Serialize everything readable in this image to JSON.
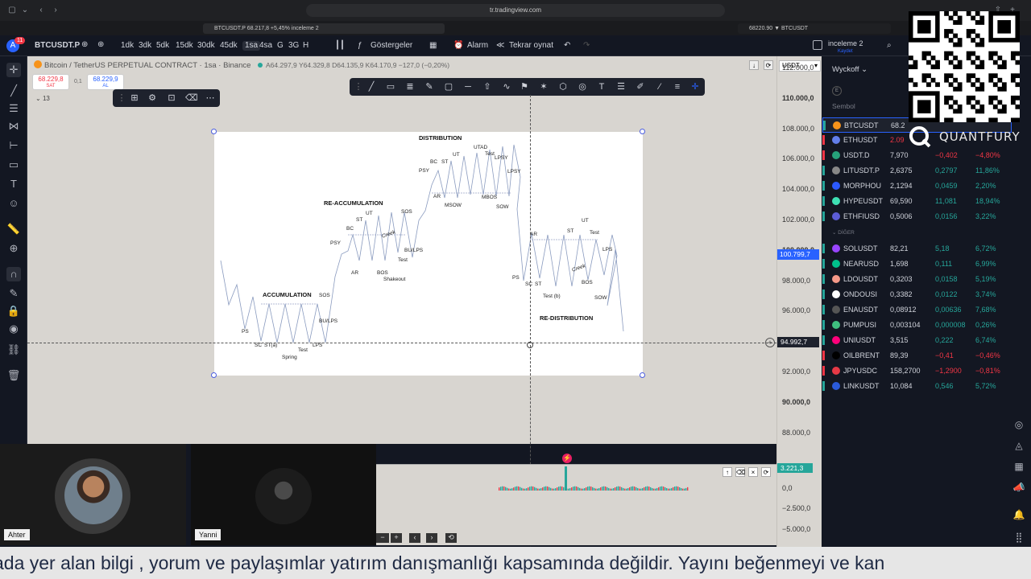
{
  "browser": {
    "url": "tr.tradingview.com"
  },
  "tabs": [
    {
      "label": "BTCUSDT.P 68.217,8 +5,45% inceleme 2"
    },
    {
      "label": "68220.90 ▼ BTCUSDT"
    }
  ],
  "toolbar": {
    "symbol": "BTCUSDT.P",
    "alert_badge": "11",
    "intervals": [
      "1dk",
      "3dk",
      "5dk",
      "15dk",
      "30dk",
      "45dk",
      "1sa",
      "4sa",
      "G",
      "3G",
      "H"
    ],
    "active_interval": "1sa",
    "indicators_label": "Göstergeler",
    "alarm_label": "Alarm",
    "replay_label": "Tekrar oynat",
    "layout_name": "inceleme 2",
    "layout_sub": "Kaydet"
  },
  "chart": {
    "title": "Bitcoin / TetherUS PERPETUAL CONTRACT · 1sa · Binance",
    "ohlc": "A64.297,9  Y64.329,8  D64.135,9  K64.170,9  −127,0 (−0,20%)",
    "sell": {
      "price": "68.229,8",
      "label": "SAT"
    },
    "spread": "0,1",
    "buy": {
      "price": "68.229,9",
      "label": "AL"
    },
    "collapse_count": "13",
    "currency": "USDT",
    "current_price": "100.799,7",
    "cursor_price": "94.992,7"
  },
  "wyckoff": {
    "accumulation": {
      "title": "ACCUMULATION",
      "labels": [
        "PS",
        "SC",
        "ST(a)",
        "Spring",
        "Test",
        "LPS",
        "SOS",
        "BU/LPS"
      ]
    },
    "reaccumulation": {
      "title": "RE-ACCUMULATION",
      "labels": [
        "PSY",
        "BC",
        "ST",
        "UT",
        "Creek",
        "SOS",
        "AR",
        "BOS",
        "Shakeout",
        "Test",
        "BU/LPS"
      ]
    },
    "distribution": {
      "title": "DISTRIBUTION",
      "labels": [
        "PSY",
        "BC",
        "ST",
        "UT",
        "UTAD",
        "Test",
        "LPSY",
        "LPSY",
        "AR",
        "MSOW",
        "MBOS",
        "SOW"
      ]
    },
    "redistribution": {
      "title": "RE-DISTRIBUTION",
      "labels": [
        "PS",
        "SC",
        "AR",
        "ST",
        "Test (b)",
        "ST",
        "UT",
        "Test",
        "Creek",
        "LPS",
        "BOS",
        "SOW"
      ]
    }
  },
  "price_axis": [
    "112.000,0",
    "110.000,0",
    "108.000,0",
    "106.000,0",
    "104.000,0",
    "102.000,0",
    "100.000,0",
    "98.000,0",
    "96.000,0",
    "94.000,0",
    "92.000,0",
    "90.000,0",
    "88.000,0"
  ],
  "indicator": {
    "value": "3.221,3",
    "ticks": [
      "0,0",
      "−2.500,0",
      "−5.000,0"
    ]
  },
  "watchlist": {
    "title": "Wyckoff",
    "column_label": "Sembol",
    "section_label": "DİĞER",
    "rows": [
      {
        "symbol": "BTCUSDT",
        "last": "68.2",
        "chg": "",
        "pct": "",
        "color": "#f7931a",
        "sign": "pos"
      },
      {
        "symbol": "ETHUSDT",
        "last": "2.09",
        "chg": "",
        "pct": "",
        "color": "#627eea",
        "sign": "neg"
      },
      {
        "symbol": "USDT.D",
        "last": "7,970",
        "chg": "−0,402",
        "pct": "−4,80%",
        "color": "#26a17b",
        "sign": "neg"
      },
      {
        "symbol": "LITUSDT.P",
        "last": "2,6375",
        "chg": "0,2797",
        "pct": "11,86%",
        "color": "#888888",
        "sign": "pos"
      },
      {
        "symbol": "MORPHOU",
        "last": "2,1294",
        "chg": "0,0459",
        "pct": "2,20%",
        "color": "#2b59ff",
        "sign": "pos"
      },
      {
        "symbol": "HYPEUSDT",
        "last": "69,590",
        "chg": "11,081",
        "pct": "18,94%",
        "color": "#3ee0b4",
        "sign": "pos"
      },
      {
        "symbol": "ETHFIUSD",
        "last": "0,5006",
        "chg": "0,0156",
        "pct": "3,22%",
        "color": "#5c5cd6",
        "sign": "pos"
      },
      {
        "symbol": "SOLUSDT",
        "last": "82,21",
        "chg": "5,18",
        "pct": "6,72%",
        "color": "#9945ff",
        "sign": "pos"
      },
      {
        "symbol": "NEARUSD",
        "last": "1,698",
        "chg": "0,111",
        "pct": "6,99%",
        "color": "#00c08b",
        "sign": "pos"
      },
      {
        "symbol": "LDOUSDT",
        "last": "0,3203",
        "chg": "0,0158",
        "pct": "5,19%",
        "color": "#f69988",
        "sign": "pos"
      },
      {
        "symbol": "ONDOUSI",
        "last": "0,3382",
        "chg": "0,0122",
        "pct": "3,74%",
        "color": "#ffffff",
        "sign": "pos"
      },
      {
        "symbol": "ENAUSDT",
        "last": "0,08912",
        "chg": "0,00636",
        "pct": "7,68%",
        "color": "#555555",
        "sign": "pos"
      },
      {
        "symbol": "PUMPUSI",
        "last": "0,003104",
        "chg": "0,000008",
        "pct": "0,26%",
        "color": "#3fbf7f",
        "sign": "pos"
      },
      {
        "symbol": "UNIUSDT",
        "last": "3,515",
        "chg": "0,222",
        "pct": "6,74%",
        "color": "#ff007a",
        "sign": "pos"
      },
      {
        "symbol": "OILBRENT",
        "last": "89,39",
        "chg": "−0,41",
        "pct": "−0,46%",
        "color": "#000000",
        "sign": "neg"
      },
      {
        "symbol": "JPYUSDC",
        "last": "158,2700",
        "chg": "−1,2900",
        "pct": "−0,81%",
        "color": "#e63946",
        "sign": "neg"
      },
      {
        "symbol": "LINKUSDT",
        "last": "10,084",
        "chg": "0,546",
        "pct": "5,72%",
        "color": "#2a5ada",
        "sign": "pos"
      }
    ]
  },
  "sponsor": {
    "brand": "QUANTFURY"
  },
  "participants": [
    {
      "name": "Ahter"
    },
    {
      "name": "Yanni"
    }
  ],
  "ticker": {
    "text": "ada yer alan bilgi , yorum ve paylaşımlar yatırım danışmanlığı kapsamında değildir. Yayını beğenmeyi ve kan"
  },
  "colors": {
    "positive": "#26a69a",
    "negative": "#f23645",
    "accent": "#2962ff",
    "chart_bg": "#d8d5d0"
  }
}
